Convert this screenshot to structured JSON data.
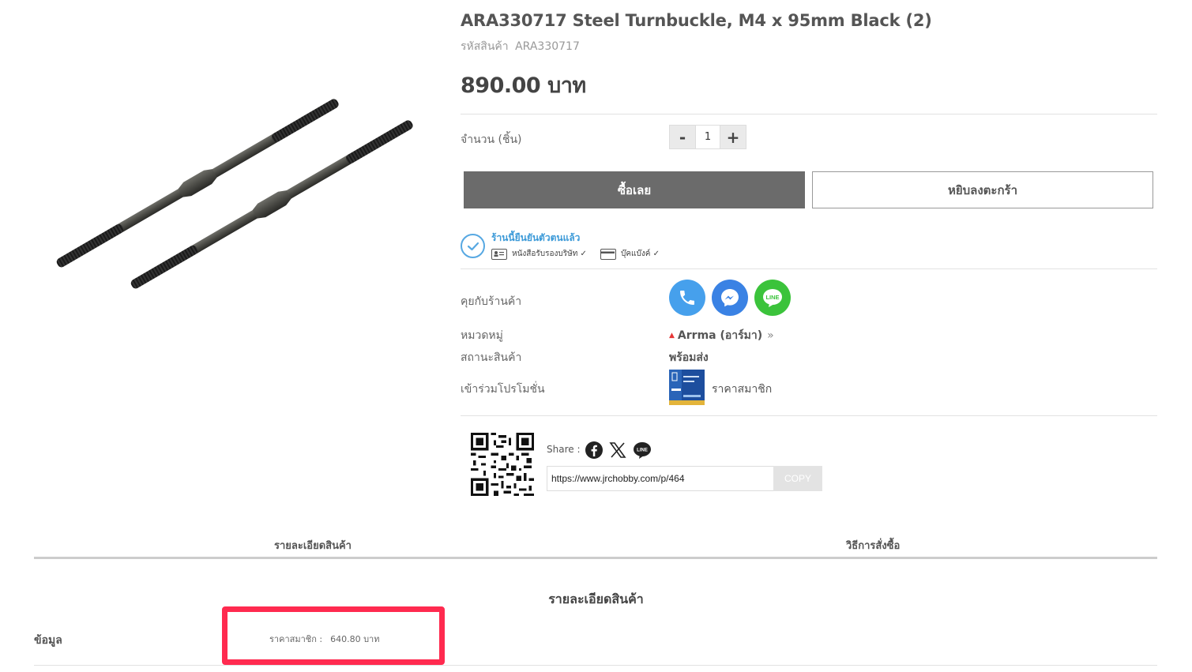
{
  "product": {
    "title": "ARA330717 Steel Turnbuckle, M4 x 95mm Black (2)",
    "sku_label": "รหัสสินค้า",
    "sku": "ARA330717",
    "price": "890.00 บาท"
  },
  "quantity": {
    "label": "จำนวน (ชิ้น)",
    "minus": "-",
    "value": "1",
    "plus": "+"
  },
  "actions": {
    "buy_now": "ซื้อเลย",
    "add_to_cart": "หยิบลงตะกร้า"
  },
  "verification": {
    "title": "ร้านนี้ยืนยันตัวตนแล้ว",
    "company_cert": "หนังสือรับรองบริษัท ✓",
    "bank_book": "บุ๊คแบ๊งค์ ✓"
  },
  "details": {
    "contact_label": "คุยกับร้านค้า",
    "category_label": "หมวดหมู่",
    "category_value": "Arrma (อาร์มา)",
    "status_label": "สถานะสินค้า",
    "status_value": "พร้อมส่ง",
    "promo_label": "เข้าร่วมโปรโมชั่น",
    "promo_value": "ราคาสมาชิก"
  },
  "contacts": {
    "phone_color": "#46a0ec",
    "messenger_color": "#3a82e4",
    "line_color": "#3bc33b",
    "line_text": "LINE"
  },
  "share": {
    "label": "Share :",
    "line_text": "LINE",
    "url": "https://www.jrchobby.com/p/464",
    "copy": "COPY"
  },
  "tabs": {
    "details": "รายละเอียดสินค้า",
    "how_to_order": "วิธีการสั่งซื้อ"
  },
  "description": {
    "title": "รายละเอียดสินค้า",
    "info_label": "ข้อมูล",
    "member_price_label": "ราคาสมาชิก :",
    "member_price_value": "640.80 บาท"
  }
}
